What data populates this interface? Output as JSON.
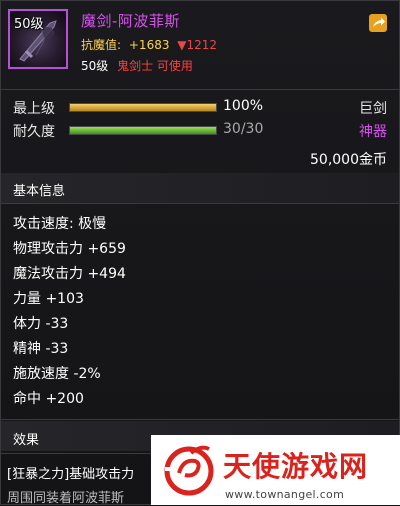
{
  "item": {
    "icon_level": "50级",
    "name": "魔剑-阿波菲斯",
    "resistance_label": "抗魔值:",
    "resistance_gain": "+1683",
    "resistance_loss": "▼1212",
    "req_level": "50级",
    "req_class": "鬼剑士 可使用"
  },
  "bars": [
    {
      "label": "最上级",
      "value_text": "100%",
      "value_color": "#ffffff",
      "fill": 1.0
    },
    {
      "label": "耐久度",
      "value_text": "30/30",
      "value_color": "#a9a9a9",
      "fill": 1.0
    }
  ],
  "type": {
    "weapon": "巨剑",
    "rarity": "神器",
    "rarity_color": "#d94ff0",
    "price": "50,000金币"
  },
  "basic": {
    "title": "基本信息",
    "attrs": [
      "攻击速度: 极慢",
      "物理攻击力 +659",
      "魔法攻击力 +494",
      "力量 +103",
      "体力 -33",
      "精神 -33",
      "施放速度 -2%",
      "命中 +200"
    ]
  },
  "effect": {
    "title": "效果",
    "line1": "[狂暴之力]基础攻击力",
    "line2": "周围同装着阿波菲斯"
  },
  "watermark": {
    "name": "天使游戏网",
    "url": "www.townangel.com"
  }
}
